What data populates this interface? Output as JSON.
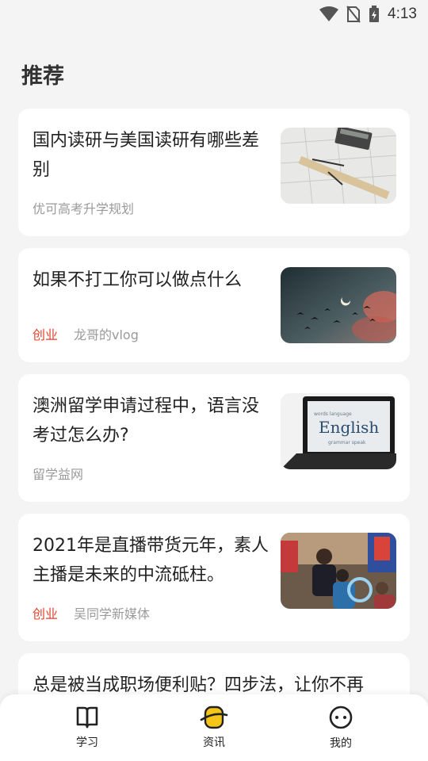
{
  "status_bar": {
    "time": "4:13"
  },
  "page": {
    "title": "推荐"
  },
  "articles": [
    {
      "title": "国内读研与美国读研有哪些差别",
      "tag": "",
      "author": "优可高考升学规划",
      "image": "drafting-tools-photo"
    },
    {
      "title": "如果不打工你可以做点什么",
      "tag": "创业",
      "author": "龙哥的vlog",
      "image": "birds-moon-sky-photo"
    },
    {
      "title": "澳洲留学申请过程中，语言没考过怎么办?",
      "tag": "",
      "author": "留学益网",
      "image": "english-laptop-photo"
    },
    {
      "title": "2021年是直播带货元年，素人主播是未来的中流砥柱。",
      "tag": "创业",
      "author": "吴同学新媒体",
      "image": "livestream-people-photo"
    },
    {
      "title": "总是被当成职场便利贴？四步法，让你不再"
    }
  ],
  "tabs": [
    {
      "label": "学习",
      "icon": "book-icon"
    },
    {
      "label": "资讯",
      "icon": "planet-icon",
      "accent": "#f5c518"
    },
    {
      "label": "我的",
      "icon": "smiley-icon"
    }
  ],
  "colors": {
    "tag": "#e2402c",
    "accent": "#f5c518",
    "background": "#f4f4f4"
  }
}
